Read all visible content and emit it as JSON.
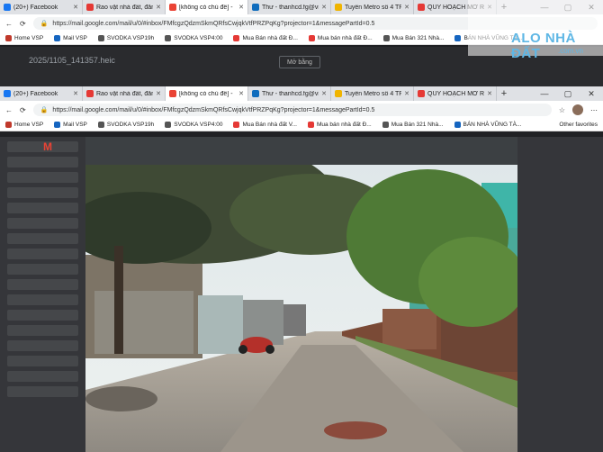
{
  "browser_back": {
    "tabs": [
      {
        "label": "(20+) Facebook",
        "color": "#1877f2"
      },
      {
        "label": "Rao vặt nhà đất, đăn",
        "color": "#e53935"
      },
      {
        "label": "[không có chủ đề] -",
        "color": "#ea4335"
      },
      {
        "label": "Thư - thanhcd.fg@vi",
        "color": "#0f6cbd"
      },
      {
        "label": "Tuyến Metro số 4 TP",
        "color": "#f0b400"
      },
      {
        "label": "QUY HOẠCH MỞ RỘ",
        "color": "#e53935"
      }
    ],
    "url": "https://mail.google.com/mail/u/0/#inbox/FMfcgzQdzmSkmQRfsCwjqkVtfPRZPqKg?projector=1&messagePartId=0.5",
    "bookmarks": [
      "Home VSP",
      "Mail VSP",
      "SVODKA VSP19h",
      "SVODKA VSP4:00",
      "Mua Bán nhà đất Đ...",
      "Mua bán nhà đất Đ...",
      "Mua Bán 321 Nhà...",
      "BÁN NHÀ VŨNG TÀ..."
    ]
  },
  "ghost": {
    "title": "2025/1105_141357.heic",
    "button": "Mở bằng"
  },
  "browser_front": {
    "tabs": [
      {
        "label": "(20+) Facebook",
        "color": "#1877f2"
      },
      {
        "label": "Rao vặt nhà đất, đăn",
        "color": "#e53935"
      },
      {
        "label": "[không có chủ đề] -",
        "color": "#ea4335"
      },
      {
        "label": "Thư - thanhcd.fg@vi",
        "color": "#0f6cbd"
      },
      {
        "label": "Tuyến Metro số 4 TP",
        "color": "#f0b400"
      },
      {
        "label": "QUY HOẠCH MỞ RỘ",
        "color": "#e53935"
      }
    ],
    "url": "https://mail.google.com/mail/u/0/#inbox/FMfcgzQdzmSkmQRfsCwjqkVtfPRZPqKg?projector=1&messagePartId=0.5",
    "bookmarks": [
      "Home VSP",
      "Mail VSP",
      "SVODKA VSP19h",
      "SVODKA VSP4:00",
      "Mua Bán nhà đất V...",
      "Mua bán nhà đất Đ...",
      "Mua Bán 321 Nhà...",
      "BÁN NHÀ VŨNG TÀ..."
    ],
    "other_favorites": "Other favorites"
  },
  "gmail_logo": "M",
  "watermark": {
    "text": "ALO NHÀ ĐẤT",
    "sub": ".com.vn"
  }
}
